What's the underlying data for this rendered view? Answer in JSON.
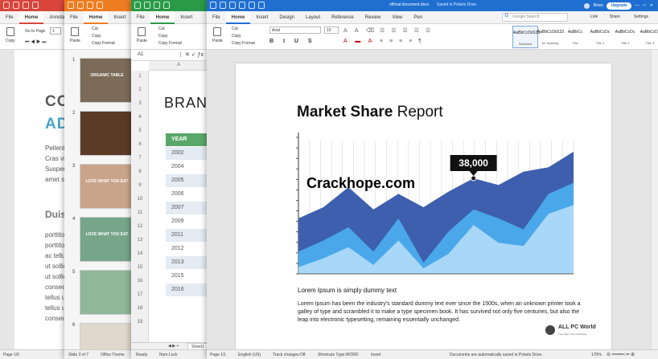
{
  "windows": {
    "doc": {
      "tabs": [
        "File",
        "Home",
        "Annotat"
      ],
      "active_tab": "Home",
      "goto_label": "Go to Page",
      "goto_value": "1",
      "copy_label": "Copy",
      "big_lines": [
        "CO",
        "AD"
      ],
      "body_lines": [
        "Pellente",
        "Cras vit",
        "Suspen",
        "amet sa"
      ],
      "heading": "Duis",
      "para_lines": [
        "porttito",
        "porttito",
        "ac tellus",
        "ut sollic",
        "ut sollic",
        "consecte",
        "tellus ut",
        "tellus ut",
        "consecte"
      ],
      "status_page": "Page 1/5",
      "colors": {
        "title": "#d9453b",
        "accent": "#4aa3c9"
      }
    },
    "slides": {
      "tabs": [
        "File",
        "Home",
        "Insert"
      ],
      "active_tab": "Home",
      "ribbon": {
        "paste": "Paste",
        "cut": "Cut",
        "copy": "Copy",
        "copy_format": "Copy Format"
      },
      "thumbs": [
        {
          "num": "1",
          "text": "ORGANIC TABLE",
          "color": "#7b6b58"
        },
        {
          "num": "2",
          "text": "",
          "color": "#5b3a26"
        },
        {
          "num": "3",
          "text": "LOVE WHAT YOU EAT",
          "color": "#c9a48a"
        },
        {
          "num": "4",
          "text": "LOVE WHAT YOU EAT",
          "color": "#76a58a"
        },
        {
          "num": "5",
          "text": "",
          "color": "#8fb79a"
        },
        {
          "num": "6",
          "text": "",
          "color": "#e0d8cc"
        }
      ],
      "status_slide": "Slide 3 of 7",
      "status_theme": "Office Theme"
    },
    "sheet": {
      "tabs": [
        "File",
        "Home",
        "Insert"
      ],
      "active_tab": "Home",
      "ribbon": {
        "paste": "Paste",
        "cut": "Cut",
        "copy": "Copy",
        "copy_format": "Copy Format"
      },
      "cell_ref": "A1",
      "col_a": "A",
      "title": "BRAN",
      "header": "YEAR",
      "years": [
        "2002",
        "2004",
        "2005",
        "2006",
        "2007",
        "2009",
        "2011",
        "2012",
        "2013",
        "2015",
        "2016"
      ],
      "row_numbers": [
        "1",
        "2",
        "3",
        "4",
        "5",
        "6",
        "7",
        "8",
        "9",
        "10",
        "11",
        "12",
        "13",
        "14",
        "15",
        "16",
        "17",
        "18",
        "19"
      ],
      "sheet_tab": "Sheet1",
      "status_ready": "Ready",
      "status_numlock": "Num Lock"
    },
    "main": {
      "titlebar_title": "official document.docx",
      "titlebar_saved": "Saved in Polaris Drive",
      "user": "Brian",
      "upgrade": "Upgrade",
      "tabs": [
        "File",
        "Home",
        "Insert",
        "Design",
        "Layout",
        "Reference",
        "Review",
        "View",
        "Pen"
      ],
      "active_tab": "Home",
      "search_placeholder": "Google Search",
      "link": "Link",
      "share": "Share",
      "settings": "Settings",
      "ribbon": {
        "paste": "Paste",
        "cut": "Cut",
        "copy": "Copy",
        "copy_format": "Copy Format",
        "font": "Arial",
        "size": "10"
      },
      "styles": [
        {
          "sample": "AaBbCcDd123",
          "name": "Standard"
        },
        {
          "sample": "AaBbCcDd123",
          "name": "No Spacing"
        },
        {
          "sample": "AaBbCc",
          "name": "Title"
        },
        {
          "sample": "AaBbCcDc",
          "name": "Title 1"
        },
        {
          "sample": "AaBbCcDc",
          "name": "Title 2"
        },
        {
          "sample": "AaBbCcDc",
          "name": "Title 3"
        }
      ],
      "status": {
        "page": "Page 1/1",
        "lang": "English (US)",
        "track": "Track changes:Off",
        "shortcuts": "Shortcuts Type:WORD",
        "insert": "Insert",
        "saved": "Documents are automatically saved in Polaris Drive.",
        "zoom": "170%"
      }
    }
  },
  "document": {
    "chart_title_bold": "Market Share",
    "chart_title_rest": " Report",
    "callout": "38,000",
    "watermark": "Crackhope.com",
    "subheading": "Lorem Ipsum is simply dummy text",
    "paragraph_lines": [
      "Lorem Ipsum has been the industry's standard dummy text ever since the 1500s, when an unknown printer took a",
      "galley of type and scrambled it to make a type specimen book. It has survived not only five centuries, but also the",
      "leap into electronic typesetting, remaining essentially unchanged."
    ],
    "logo_text": "ALL PC World",
    "logo_sub": "Free Apps One Click Away"
  },
  "chart_data": {
    "type": "area",
    "title": "Market Share Report",
    "x": [
      1,
      2,
      3,
      4,
      5,
      6,
      7,
      8,
      9,
      10,
      11,
      12
    ],
    "series": [
      {
        "values": [
          50,
          60,
          78,
          58,
          72,
          60,
          74,
          86,
          80,
          92,
          96,
          110
        ],
        "color": "#3d5fad"
      },
      {
        "values": [
          20,
          30,
          42,
          20,
          50,
          10,
          38,
          58,
          50,
          40,
          72,
          82
        ],
        "color": "#4aa8ea"
      },
      {
        "values": [
          6,
          14,
          24,
          8,
          30,
          5,
          18,
          44,
          28,
          25,
          54,
          62
        ],
        "color": "#a9d7f7"
      }
    ],
    "callout_index": 7,
    "callout_value": "38,000",
    "ylim": [
      0,
      120
    ],
    "grid": "vertical"
  }
}
